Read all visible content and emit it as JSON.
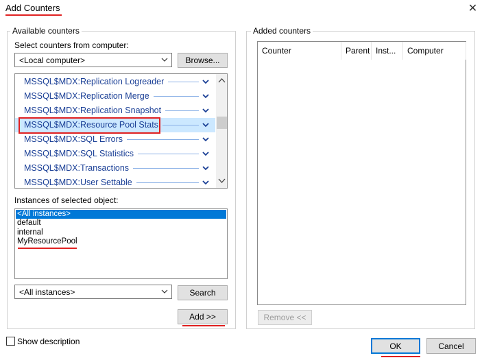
{
  "window": {
    "title": "Add Counters",
    "close_glyph": "✕"
  },
  "available": {
    "group_label": "Available counters",
    "computer_label": "Select counters from computer:",
    "computer_value": "<Local computer>",
    "browse_label": "Browse...",
    "counters": [
      {
        "label": "MSSQL$MDX:Replication Logreader",
        "selected": false
      },
      {
        "label": "MSSQL$MDX:Replication Merge",
        "selected": false
      },
      {
        "label": "MSSQL$MDX:Replication Snapshot",
        "selected": false
      },
      {
        "label": "MSSQL$MDX:Resource Pool Stats",
        "selected": true
      },
      {
        "label": "MSSQL$MDX:SQL Errors",
        "selected": false
      },
      {
        "label": "MSSQL$MDX:SQL Statistics",
        "selected": false
      },
      {
        "label": "MSSQL$MDX:Transactions",
        "selected": false
      },
      {
        "label": "MSSQL$MDX:User Settable",
        "selected": false
      }
    ],
    "instances_label": "Instances of selected object:",
    "instances": [
      {
        "label": "<All instances>",
        "selected": true
      },
      {
        "label": "default",
        "selected": false
      },
      {
        "label": "internal",
        "selected": false
      },
      {
        "label": "MyResourcePool",
        "selected": false
      }
    ],
    "instance_filter_value": "<All instances>",
    "search_label": "Search",
    "add_label": "Add >>"
  },
  "added": {
    "group_label": "Added counters",
    "columns": [
      "Counter",
      "Parent",
      "Inst...",
      "Computer"
    ],
    "remove_label": "Remove <<"
  },
  "footer": {
    "show_description_label": "Show description",
    "ok_label": "OK",
    "cancel_label": "Cancel"
  },
  "colors": {
    "annotation_red": "#e02020",
    "counter_text": "#1a3f96",
    "selection_blue": "#0078d7",
    "selection_light": "#cce8ff"
  }
}
